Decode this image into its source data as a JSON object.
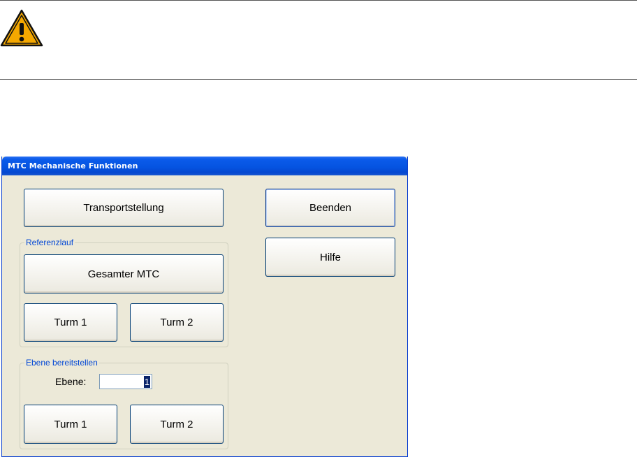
{
  "dialog": {
    "title": "MTC Mechanische Funktionen",
    "buttons": {
      "transport": "Transportstellung",
      "exit": "Beenden",
      "help": "Hilfe"
    },
    "referenzlauf": {
      "legend": "Referenzlauf",
      "all": "Gesamter MTC",
      "tower1": "Turm 1",
      "tower2": "Turm 2"
    },
    "ebene": {
      "legend": "Ebene bereitstellen",
      "label": "Ebene:",
      "value": "1",
      "tower1": "Turm 1",
      "tower2": "Turm 2"
    }
  },
  "colors": {
    "titlebar": "#0554e1",
    "dialog_bg": "#ece9d8",
    "legend_text": "#0046d5",
    "warning_fill": "#f5a800"
  },
  "icons": {
    "warning": "warning-triangle-icon"
  }
}
